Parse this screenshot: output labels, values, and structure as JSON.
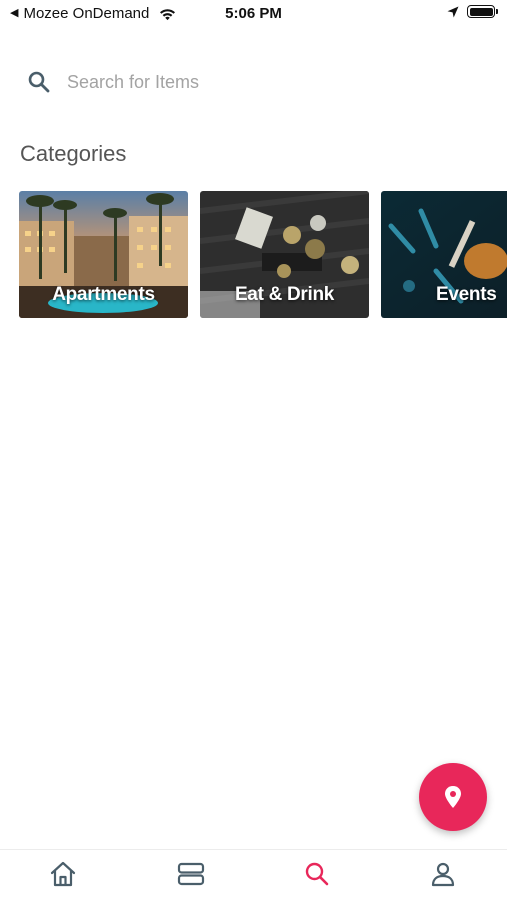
{
  "status_bar": {
    "back_app": "Mozee OnDemand",
    "time": "5:06 PM"
  },
  "search": {
    "placeholder": "Search for Items",
    "value": ""
  },
  "categories": {
    "title": "Categories",
    "items": [
      {
        "label": "Apartments"
      },
      {
        "label": "Eat & Drink"
      },
      {
        "label": "Events"
      }
    ]
  },
  "colors": {
    "accent": "#e8275a",
    "nav_icon": "#4a5e6a",
    "nav_active": "#e8275a"
  },
  "bottom_nav": {
    "items": [
      {
        "icon": "home-icon",
        "active": false
      },
      {
        "icon": "list-icon",
        "active": false
      },
      {
        "icon": "search-icon",
        "active": true
      },
      {
        "icon": "profile-icon",
        "active": false
      }
    ]
  },
  "fab": {
    "icon": "map-pin-icon"
  }
}
